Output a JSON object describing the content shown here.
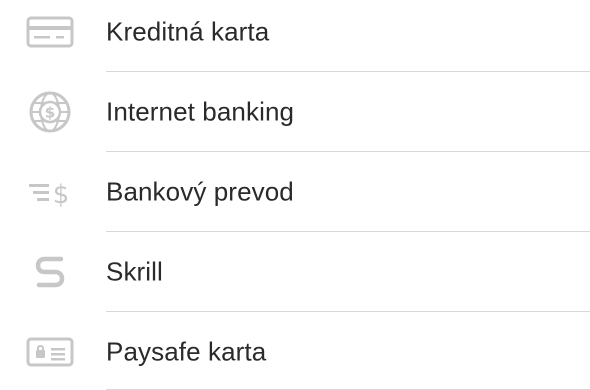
{
  "payment_methods": [
    {
      "label": "Kreditná karta",
      "icon": "credit-card-icon"
    },
    {
      "label": "Internet banking",
      "icon": "globe-dollar-icon"
    },
    {
      "label": "Bankový prevod",
      "icon": "bank-transfer-icon"
    },
    {
      "label": "Skrill",
      "icon": "skrill-icon"
    },
    {
      "label": "Paysafe karta",
      "icon": "paysafe-card-icon"
    }
  ],
  "colors": {
    "icon": "#c7c7c7",
    "divider": "#d8d8d8",
    "text": "#2a2a2a"
  }
}
